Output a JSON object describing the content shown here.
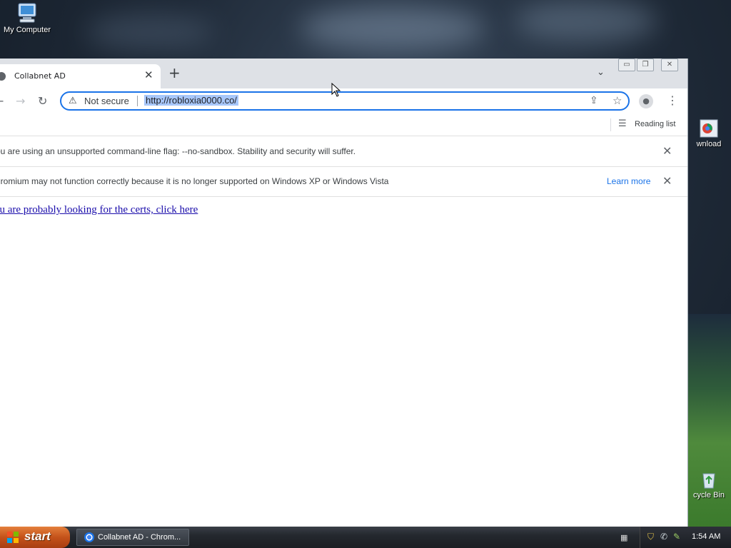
{
  "desktop": {
    "icons": [
      {
        "label": "My Computer"
      },
      {
        "label": "wnload"
      },
      {
        "label": "cycle Bin"
      }
    ]
  },
  "browser": {
    "tab": {
      "title": "Collabnet AD",
      "close_glyph": "✕"
    },
    "newtab_glyph": "+",
    "tabsearch_glyph": "⌄",
    "window_controls": {
      "minimize": "▭",
      "restore": "❐",
      "close": "✕"
    },
    "nav": {
      "back": "←",
      "forward": "→",
      "reload": "↻"
    },
    "omnibox": {
      "security_label": "Not secure",
      "url": "http://robloxia0000.co/"
    },
    "toolbar": {
      "share": "⇪",
      "star": "☆",
      "menu": "⋮",
      "profile": "●"
    },
    "bookmarks": {
      "reading_list": "Reading list",
      "reading_list_icon": "☰"
    },
    "infobars": [
      {
        "message": "ou are using an unsupported command-line flag: --no-sandbox. Stability and security will suffer.",
        "close": "✕"
      },
      {
        "message": "hromium may not function correctly because it is no longer supported on Windows XP or Windows Vista",
        "link": "Learn more",
        "close": "✕"
      }
    ],
    "page": {
      "link_text": "ou are probably looking for the certs, click here"
    }
  },
  "taskbar": {
    "start_label": "start",
    "task_button": "Collabnet AD - Chrom...",
    "clock": "1:54 AM"
  }
}
